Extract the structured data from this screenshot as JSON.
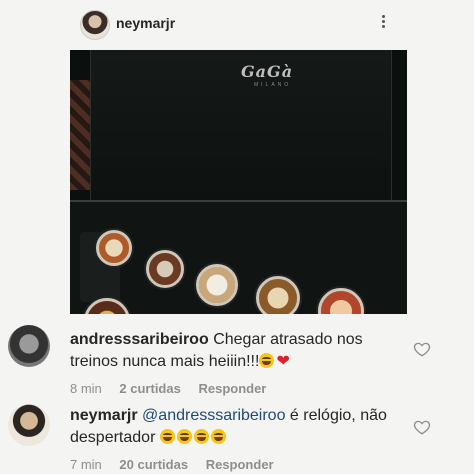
{
  "post": {
    "username": "neymarjr",
    "brand": "GaGà",
    "brand_sub": "MILANO"
  },
  "comments": [
    {
      "username": "andresssaribeiroo",
      "text": "Chegar atrasado nos treinos nunca mais heiiin!!!",
      "emojis": [
        "😂",
        "❤"
      ],
      "time": "8 min",
      "likes": "2 curtidas",
      "reply": "Responder"
    },
    {
      "username": "neymarjr",
      "mention": "@andresssaribeiroo",
      "text": "é relógio, não despertador",
      "emojis": [
        "😂",
        "😂",
        "😂",
        "😂"
      ],
      "time": "7 min",
      "likes": "20 curtidas",
      "reply": "Responder"
    }
  ],
  "colors": {
    "mention": "#1e4b78",
    "meta": "#8e8e8e",
    "heart": "#e0202a"
  },
  "icons": [
    "more-options-icon",
    "like-heart-icon"
  ]
}
